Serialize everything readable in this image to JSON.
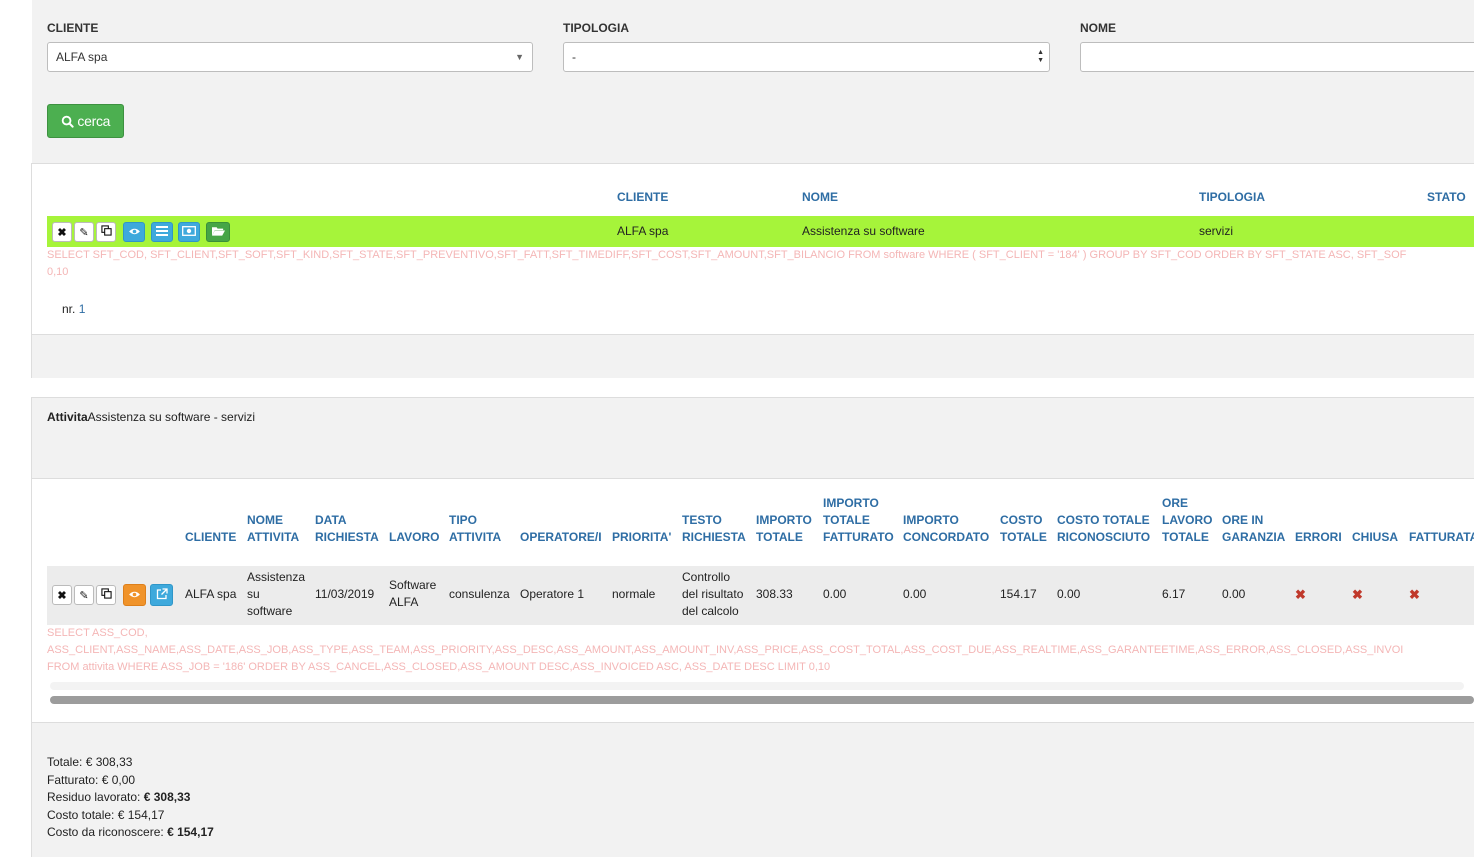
{
  "filters": {
    "cliente_label": "CLIENTE",
    "cliente_value": "ALFA spa",
    "tipologia_label": "TIPOLOGIA",
    "tipologia_value": "-",
    "nome_label": "NOME",
    "nome_value": "",
    "search_button": "cerca"
  },
  "software_table": {
    "headers": {
      "cliente": "CLIENTE",
      "nome": "NOME",
      "tipologia": "TIPOLOGIA",
      "stato": "STATO"
    },
    "row": {
      "cliente": "ALFA spa",
      "nome": "Assistenza su software",
      "tipologia": "servizi",
      "stato": ""
    },
    "sql_line1": "SELECT SFT_COD, SFT_CLIENT,SFT_SOFT,SFT_KIND,SFT_STATE,SFT_PREVENTIVO,SFT_FATT,SFT_TIMEDIFF,SFT_COST,SFT_AMOUNT,SFT_BILANCIO FROM software WHERE ( SFT_CLIENT = '184' ) GROUP BY SFT_COD ORDER BY SFT_STATE ASC, SFT_SOF",
    "sql_line2": "0,10",
    "count_label": "nr.",
    "count_value": "1",
    "row_color": "#a6f43a"
  },
  "activity": {
    "title_bold": "Attivita",
    "title_rest": "Assistenza su software - servizi",
    "headers": {
      "cliente": [
        "CLIENTE"
      ],
      "nome_attivita": [
        "NOME",
        "ATTIVITA"
      ],
      "data_richiesta": [
        "DATA",
        "RICHIESTA"
      ],
      "lavoro": [
        "LAVORO"
      ],
      "tipo_attivita": [
        "TIPO",
        "ATTIVITA"
      ],
      "operatore": [
        "OPERATORE/I"
      ],
      "priorita": [
        "PRIORITA'"
      ],
      "testo_richiesta": [
        "TESTO",
        "RICHIESTA"
      ],
      "importo_totale": [
        "IMPORTO",
        "TOTALE"
      ],
      "importo_totale_fatturato": [
        "IMPORTO",
        "TOTALE",
        "FATTURATO"
      ],
      "importo_concordato": [
        "IMPORTO",
        "CONCORDATO"
      ],
      "costo_totale": [
        "COSTO",
        "TOTALE"
      ],
      "costo_totale_riconosciuto": [
        "COSTO TOTALE",
        "RICONOSCIUTO"
      ],
      "ore_lavoro_totale": [
        "ORE",
        "LAVORO",
        "TOTALE"
      ],
      "ore_in_garanzia": [
        "ORE IN",
        "GARANZIA"
      ],
      "errori": [
        "ERRORI"
      ],
      "chiusa": [
        "CHIUSA"
      ],
      "fatturata": [
        "FATTURATA"
      ]
    },
    "row": {
      "cliente": "ALFA spa",
      "nome_attivita": [
        "Assistenza",
        "su",
        "software"
      ],
      "data_richiesta": "11/03/2019",
      "lavoro": [
        "Software",
        "ALFA"
      ],
      "tipo_attivita": "consulenza",
      "operatore": "Operatore 1",
      "priorita": "normale",
      "testo_richiesta": [
        "Controllo",
        "del risultato",
        "del calcolo"
      ],
      "importo_totale": "308.33",
      "importo_totale_fatturato": "0.00",
      "importo_concordato": "0.00",
      "costo_totale": "154.17",
      "costo_totale_riconosciuto": "0.00",
      "ore_lavoro_totale": "6.17",
      "ore_in_garanzia": "0.00",
      "errori": "✖",
      "chiusa": "✖",
      "fatturata": "✖"
    },
    "sql_line1": "SELECT ASS_COD,",
    "sql_line2": "ASS_CLIENT,ASS_NAME,ASS_DATE,ASS_JOB,ASS_TYPE,ASS_TEAM,ASS_PRIORITY,ASS_DESC,ASS_AMOUNT,ASS_AMOUNT_INV,ASS_PRICE,ASS_COST_TOTAL,ASS_COST_DUE,ASS_REALTIME,ASS_GARANTEETIME,ASS_ERROR,ASS_CLOSED,ASS_INVOI",
    "sql_line3": "FROM attivita WHERE ASS_JOB = '186' ORDER BY ASS_CANCEL,ASS_CLOSED,ASS_AMOUNT DESC,ASS_INVOICED ASC, ASS_DATE DESC LIMIT 0,10"
  },
  "summary": {
    "totale_label": "Totale:",
    "totale_value": "€ 308,33",
    "fatturato_label": "Fatturato:",
    "fatturato_value": "€ 0,00",
    "residuo_label": "Residuo lavorato:",
    "residuo_value": "€ 308,33",
    "costo_totale_label": "Costo totale:",
    "costo_totale_value": "€ 154,17",
    "costo_riconoscere_label": "Costo da riconoscere:",
    "costo_riconoscere_value": "€ 154,17"
  }
}
